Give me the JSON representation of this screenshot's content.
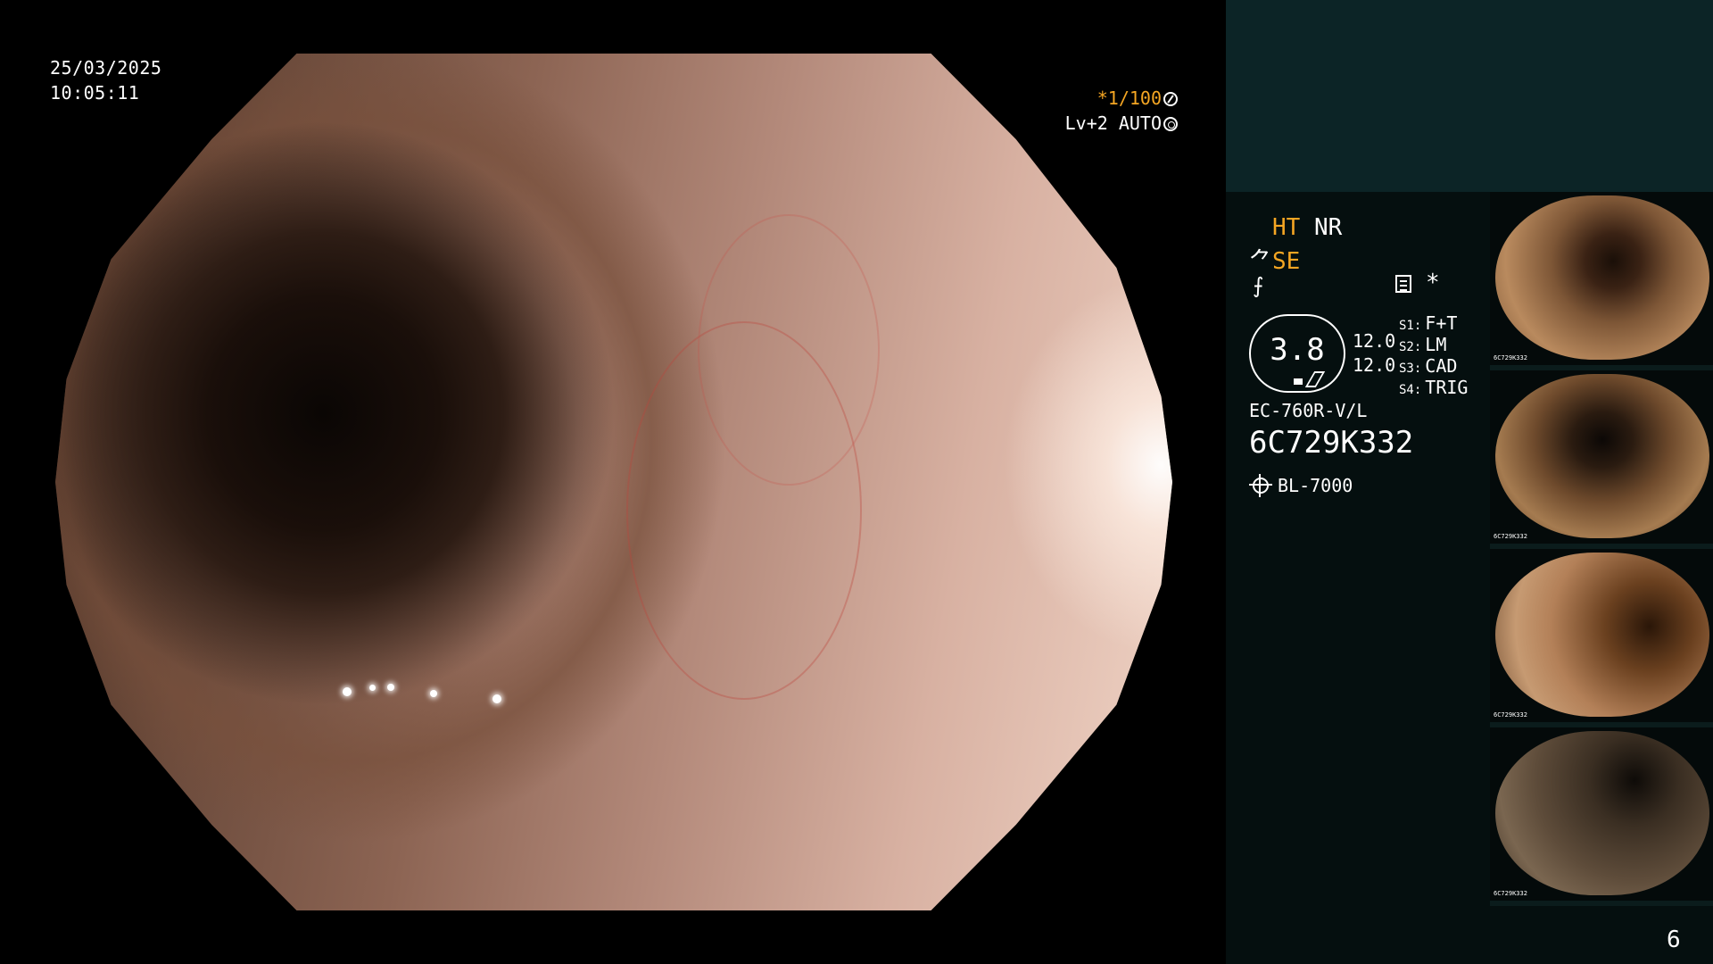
{
  "osd": {
    "date": "25/03/2025",
    "time": "10:05:11",
    "shutter_prefix": "*",
    "shutter": "1/100",
    "level": "Lv+2",
    "iris": "AUTO"
  },
  "panel": {
    "mode_ht": "HT",
    "mode_nr": "NR",
    "mode_se": "SE",
    "mode_se_prefix": "⺈",
    "mode_f": "⨍",
    "asterisk": "*",
    "gauge_value": "3.8",
    "value_a": "12.0",
    "value_b": "12.0",
    "s_buttons": [
      {
        "key": "S1:",
        "value": "F+T"
      },
      {
        "key": "S2:",
        "value": "LM"
      },
      {
        "key": "S3:",
        "value": "CAD"
      },
      {
        "key": "S4:",
        "value": "TRIG"
      }
    ],
    "scope_model": "EC-760R-V/L",
    "scope_serial": "6C729K332",
    "light_source": "BL-7000"
  },
  "thumbnails": [
    {
      "label": "6C729K332"
    },
    {
      "label": "6C729K332"
    },
    {
      "label": "6C729K332"
    },
    {
      "label": "6C729K332"
    }
  ],
  "page_number": "6",
  "colors": {
    "highlight": "#f5a623",
    "panel_top": "#0c2426",
    "panel_bg": "#050f0f"
  }
}
